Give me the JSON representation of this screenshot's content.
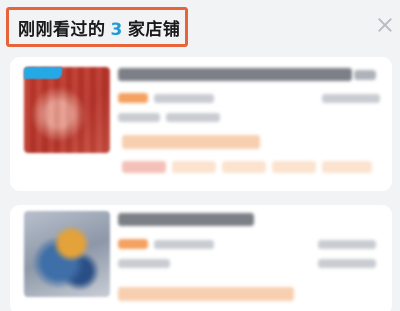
{
  "header": {
    "title_prefix": "刚刚看过的",
    "count": "3",
    "title_suffix": "家店铺"
  },
  "icons": {
    "close": "close-icon"
  },
  "colors": {
    "title_frame": "#e8623a",
    "count_accent": "#1e9bd7",
    "badge": "#25a9e6"
  },
  "shops": [
    {
      "index": 1,
      "has_badge": true
    },
    {
      "index": 2,
      "has_badge": false
    }
  ]
}
